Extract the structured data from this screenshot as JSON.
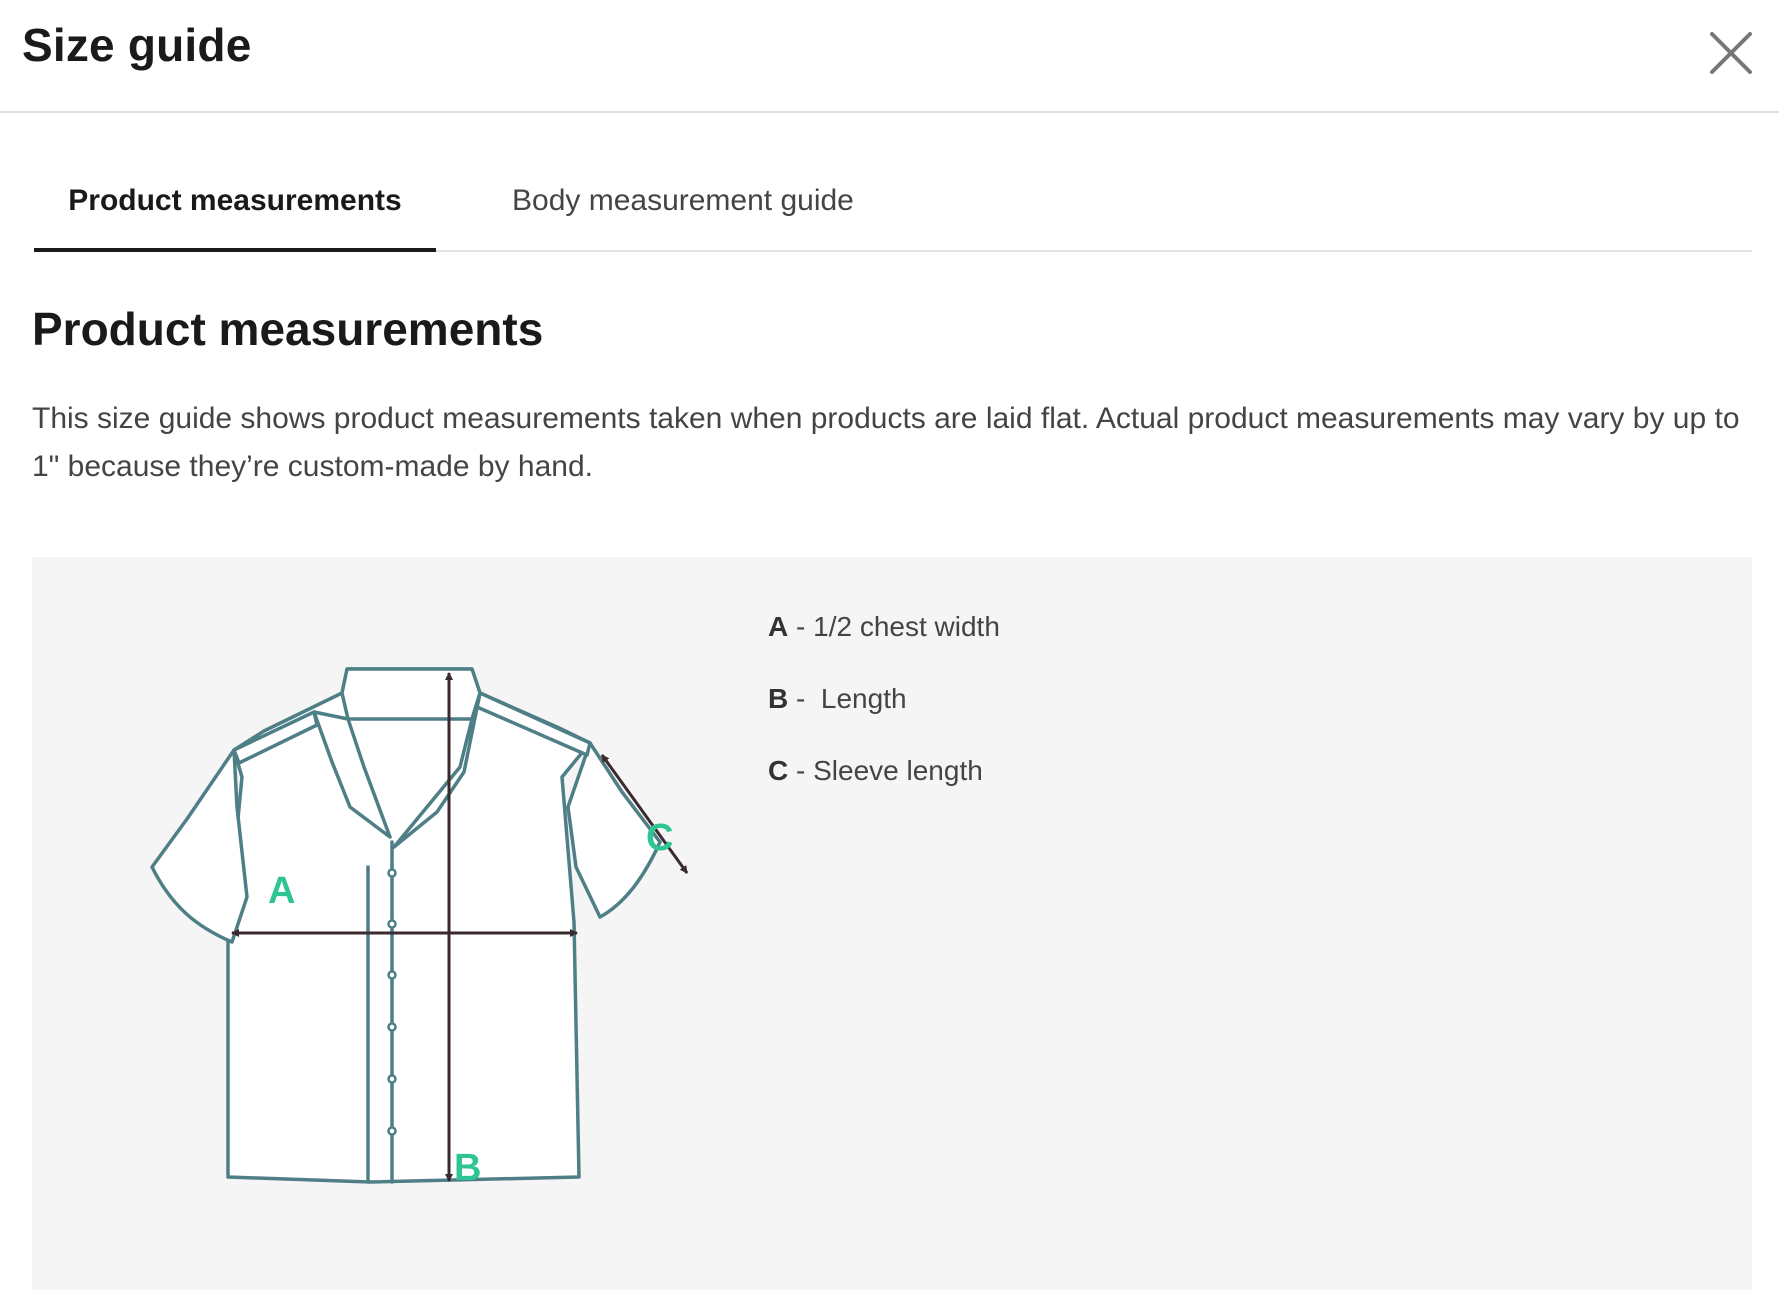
{
  "header": {
    "title": "Size guide",
    "close_icon": "close-icon"
  },
  "tabs": [
    {
      "label": "Product measurements",
      "active": true
    },
    {
      "label": "Body measurement guide",
      "active": false
    }
  ],
  "section": {
    "title": "Product measurements",
    "description": "This size guide shows product measurements taken when products are laid flat. Actual product measurements may vary by up to 1\" because they’re custom-made by hand."
  },
  "diagram": {
    "labels": {
      "a": "A",
      "b": "B",
      "c": "C"
    },
    "colors": {
      "outline": "#4f7f86",
      "arrow": "#3a2a2e",
      "label": "#2fc494"
    }
  },
  "legend": [
    {
      "key": "A",
      "separator": " - ",
      "text": "1/2 chest width"
    },
    {
      "key": "B",
      "separator": " -  ",
      "text": "Length"
    },
    {
      "key": "C",
      "separator": " - ",
      "text": "Sleeve length"
    }
  ],
  "colors": {
    "panel_background": "#f5f5f5",
    "active_tab_underline": "#1a1a1a"
  }
}
